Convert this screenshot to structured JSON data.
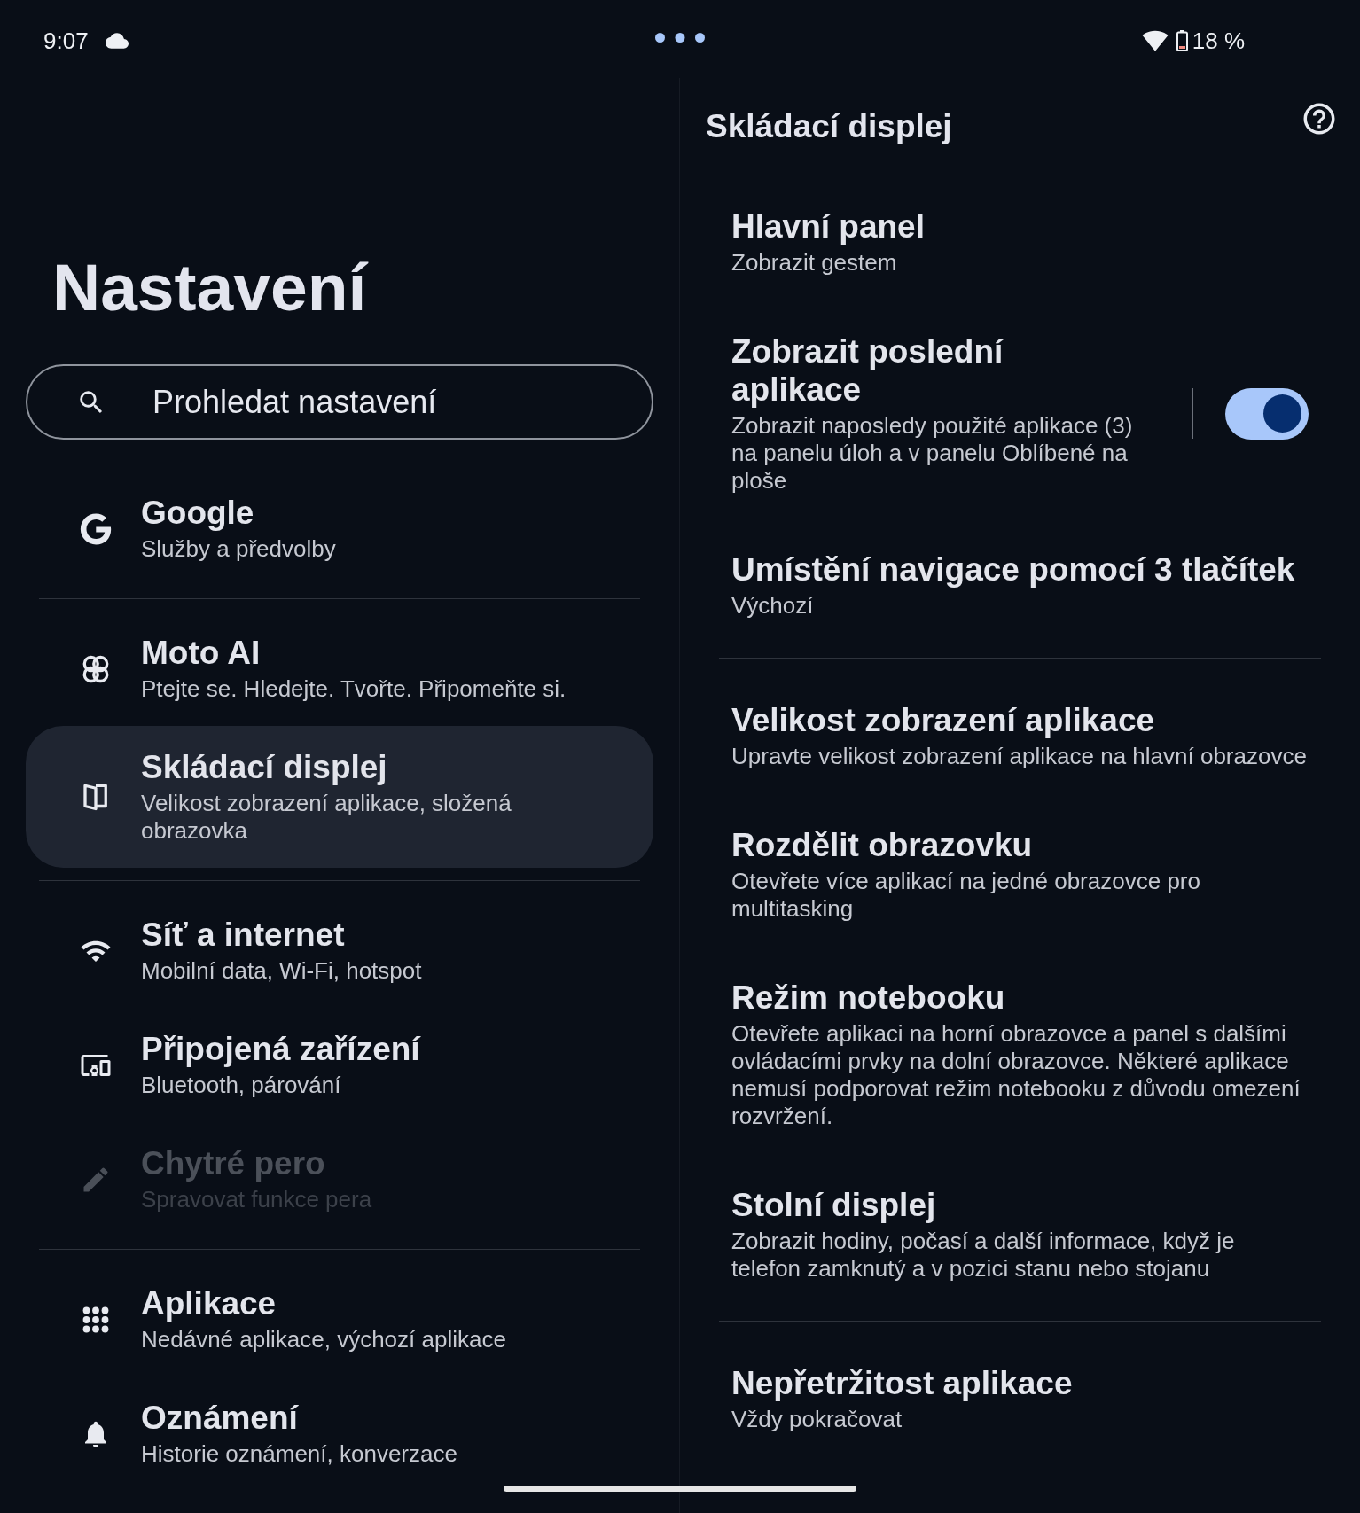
{
  "status_bar": {
    "time": "9:07",
    "battery": "18 %"
  },
  "settings": {
    "title": "Nastavení",
    "search": {
      "placeholder": "Prohledat nastavení"
    },
    "groups": [
      {
        "items": [
          {
            "title": "Google",
            "subtitle": "Služby a předvolby",
            "selected": false,
            "disabled": false
          }
        ]
      },
      {
        "items": [
          {
            "title": "Moto AI",
            "subtitle": "Ptejte se. Hledejte. Tvořte. Připomeňte si.",
            "selected": false,
            "disabled": false
          },
          {
            "title": "Skládací displej",
            "subtitle": "Velikost zobrazení aplikace, složená obrazovka",
            "selected": true,
            "disabled": false
          }
        ]
      },
      {
        "items": [
          {
            "title": "Síť a internet",
            "subtitle": "Mobilní data, Wi-Fi, hotspot",
            "selected": false,
            "disabled": false
          },
          {
            "title": "Připojená zařízení",
            "subtitle": "Bluetooth, párování",
            "selected": false,
            "disabled": false
          },
          {
            "title": "Chytré pero",
            "subtitle": "Spravovat funkce pera",
            "selected": false,
            "disabled": true
          }
        ]
      },
      {
        "items": [
          {
            "title": "Aplikace",
            "subtitle": "Nedávné aplikace, výchozí aplikace",
            "selected": false,
            "disabled": false
          },
          {
            "title": "Oznámení",
            "subtitle": "Historie oznámení, konverzace",
            "selected": false,
            "disabled": false
          }
        ]
      }
    ]
  },
  "detail": {
    "title": "Skládací displej",
    "groups": [
      {
        "items": [
          {
            "kind": "text",
            "title": "Hlavní panel",
            "subtitle": "Zobrazit gestem"
          },
          {
            "kind": "toggle",
            "title": "Zobrazit poslední aplikace",
            "subtitle": "Zobrazit naposledy použité aplikace (3) na panelu úloh a v panelu Oblíbené na ploše",
            "on": true
          },
          {
            "kind": "text",
            "title": "Umístění navigace pomocí 3 tlačítek",
            "subtitle": "Výchozí"
          }
        ]
      },
      {
        "items": [
          {
            "kind": "text",
            "title": "Velikost zobrazení aplikace",
            "subtitle": "Upravte velikost zobrazení aplikace na hlavní obrazovce"
          },
          {
            "kind": "text",
            "title": "Rozdělit obrazovku",
            "subtitle": "Otevřete více aplikací na jedné obrazovce pro multitasking"
          },
          {
            "kind": "text",
            "title": "Režim notebooku",
            "subtitle": "Otevřete aplikaci na horní obrazovce a panel s dalšími ovládacími prvky na dolní obrazovce. Některé aplikace nemusí podporovat režim notebooku z důvodu omezení rozvržení."
          },
          {
            "kind": "text",
            "title": "Stolní displej",
            "subtitle": "Zobrazit hodiny, počasí a další informace, když je telefon zamknutý a v pozici stanu nebo stojanu"
          }
        ]
      },
      {
        "items": [
          {
            "kind": "text",
            "title": "Nepřetržitost aplikace",
            "subtitle": "Vždy pokračovat"
          }
        ]
      }
    ]
  }
}
